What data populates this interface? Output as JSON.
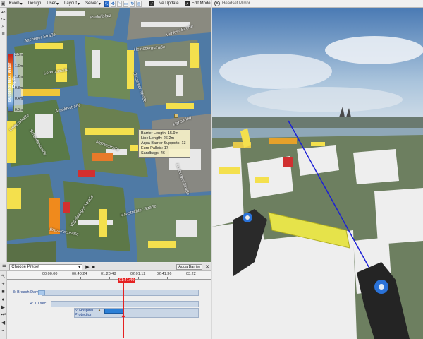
{
  "menubar": {
    "app_label": "Kweh",
    "menus": [
      "Design",
      "User",
      "Layout",
      "Server"
    ],
    "live_update_label": "Live Update",
    "live_update_checked": true,
    "edit_mode_label": "Edit Mode",
    "edit_mode_checked": true
  },
  "map": {
    "legend": {
      "title": "Buildings Max. Water Depth",
      "ticks": [
        "2.0m",
        "1.6m",
        "1.2m",
        "0.8m",
        "0.4m",
        "0.0m"
      ]
    },
    "streets": [
      "Aachener Straße",
      "Lorenzstraße",
      "Arnoldsstraße",
      "Schaefenstraße",
      "Lindenstraße",
      "Rudolfplatz",
      "Moltkestraße",
      "Brüsseler Straße",
      "Vogelsanger Straße",
      "Hansaring",
      "Maastrichter Straße",
      "Limburger Straße",
      "Venloer Straße",
      "Heinsbergstraße",
      "Bismarckstraße"
    ],
    "tooltip": {
      "lines": [
        "Barrier Length: 15.9m",
        "Line Length: 26.2m",
        "Aqua Barrier Supports: 13",
        "Euro Pallets: 17",
        "Sandbags: 46"
      ]
    }
  },
  "timeline": {
    "preset_label": "Choose Preset",
    "object_label": "Aqua Barrier",
    "ruler_labels": [
      "00:00:00",
      "00:40:24",
      "01:20:48",
      "02:01:12",
      "02:41:36",
      "03:22"
    ],
    "cursor_time": "01:41:40",
    "tracks": [
      {
        "label": "3: Breach Dam",
        "value": ""
      },
      {
        "label": "4: 10 sec",
        "value": ""
      },
      {
        "label": "5: Hospital Protection",
        "value": ""
      }
    ]
  },
  "headset": {
    "title": "Headset Mirror",
    "close_icon": "close-icon"
  },
  "colors": {
    "water": "#4f7aa5",
    "flood_red": "#d32f2f",
    "flood_yellow": "#f4e04d",
    "clip_blue": "#2b7fd6",
    "cursor_red": "#e52222",
    "barrier_yellow": "#e6e34a",
    "controller_blue": "#2a72d8"
  }
}
